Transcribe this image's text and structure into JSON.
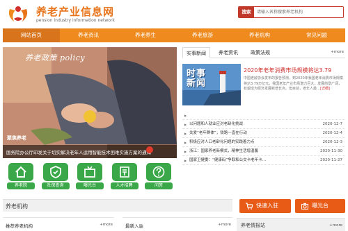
{
  "header": {
    "site_name": "养老产业信息网",
    "site_subtitle": "pension industry information network",
    "search_label": "搜索",
    "search_placeholder": "请输入名称搜索养老机构"
  },
  "nav": {
    "items": [
      "网站首页",
      "养老资讯",
      "养老养生",
      "养老旅游",
      "养老机构",
      "常见问题"
    ],
    "active_index": 0
  },
  "banner": {
    "title": "养老政策 policy",
    "stamp": "聚焦养老",
    "caption": "国务院办公厅印发关于切实解决老年人运用智能技术困难实施方案的通知"
  },
  "quick_links": [
    {
      "label": "养老院",
      "icon": "house-icon"
    },
    {
      "label": "社保查询",
      "icon": "shield-icon"
    },
    {
      "label": "曝光台",
      "icon": "tv-icon"
    },
    {
      "label": "人才招聘",
      "icon": "recruit-icon"
    },
    {
      "label": "问答",
      "icon": "question-icon"
    }
  ],
  "news": {
    "tabs": [
      "实事新闻",
      "养老资讯",
      "政策法规"
    ],
    "more": "+more",
    "featured": {
      "image_text_line1": "时事",
      "image_text_line2": "新闻",
      "title": "2020年老年消费市场规模将达3.79",
      "description": "中国老龄协会发布的报告预测，到2020年我国老年消费市场规模将达3.79万亿元，我国老年产业市场潜力巨大，发展前景广阔，有望成为经济发展新增长点。但目前，老年人最…",
      "detail": "[详细]"
    },
    "items": [
      {
        "title": "",
        "date": ""
      },
      {
        "title": "以问题和人就业应对老龄化挑战",
        "date": "2020-12-7"
      },
      {
        "title": "关爱“老年群体”，铁路一直在行动",
        "date": "2020-12-4"
      },
      {
        "title": "积极应对人口老龄化问题的实践着力点",
        "date": "2020-12-3"
      },
      {
        "title": "浙江：国家养老新模式，精神生活增温馨",
        "date": "2020-11-30"
      },
      {
        "title": "国家卫健委：“健康码”争取和公交卡老年卡…",
        "date": "2020-11-27"
      }
    ]
  },
  "bottom": {
    "section_title": "养老机构",
    "recommend_title": "推荐养老机构",
    "latest_title": "最新入驻",
    "more": "+more",
    "join_button": "快速入驻",
    "expose_button": "曝光台",
    "report_title": "养老情报站"
  },
  "colors": {
    "brand_orange": "#ef8a1f",
    "accent_red": "#d0312d",
    "quick_green": "#3aa848"
  }
}
